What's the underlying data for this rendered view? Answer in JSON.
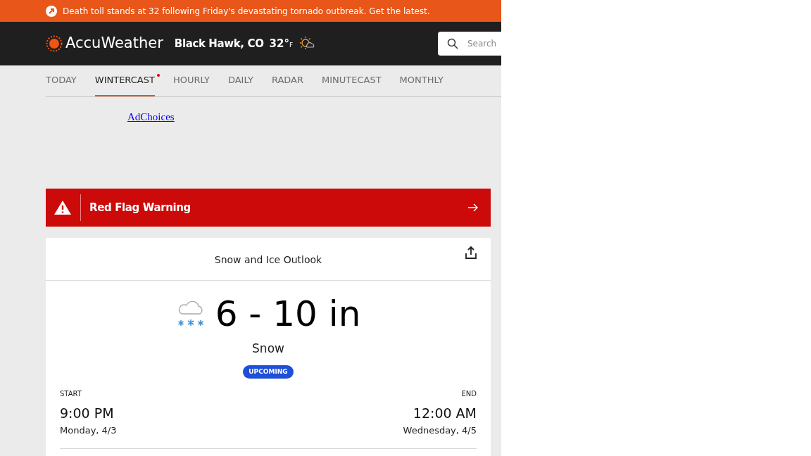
{
  "alert_banner": {
    "text": "Death toll stands at 32 following Friday's devastating tornado outbreak. Get the latest."
  },
  "header": {
    "logo": "AccuWeather",
    "location": "Black Hawk, CO",
    "temperature": "32°",
    "unit": "F",
    "search": {
      "placeholder": "Search"
    }
  },
  "tabs": [
    {
      "label": "TODAY",
      "selected": false,
      "dot": false
    },
    {
      "label": "WINTERCAST",
      "selected": true,
      "dot": true
    },
    {
      "label": "HOURLY",
      "selected": false,
      "dot": false
    },
    {
      "label": "DAILY",
      "selected": false,
      "dot": false
    },
    {
      "label": "RADAR",
      "selected": false,
      "dot": false
    },
    {
      "label": "MINUTECAST",
      "selected": false,
      "dot": false
    },
    {
      "label": "MONTHLY",
      "selected": false,
      "dot": false
    }
  ],
  "ad": {
    "link": "AdChoices"
  },
  "warning": {
    "title": "Red Flag Warning"
  },
  "outlook": {
    "title": "Snow and Ice Outlook",
    "amount": "6 - 10 in",
    "type": "Snow",
    "badge": "UPCOMING",
    "start": {
      "label": "START",
      "time": "9:00 PM",
      "date": "Monday, 4/3"
    },
    "end": {
      "label": "END",
      "time": "12:00 AM",
      "date": "Wednesday, 4/5"
    }
  }
}
